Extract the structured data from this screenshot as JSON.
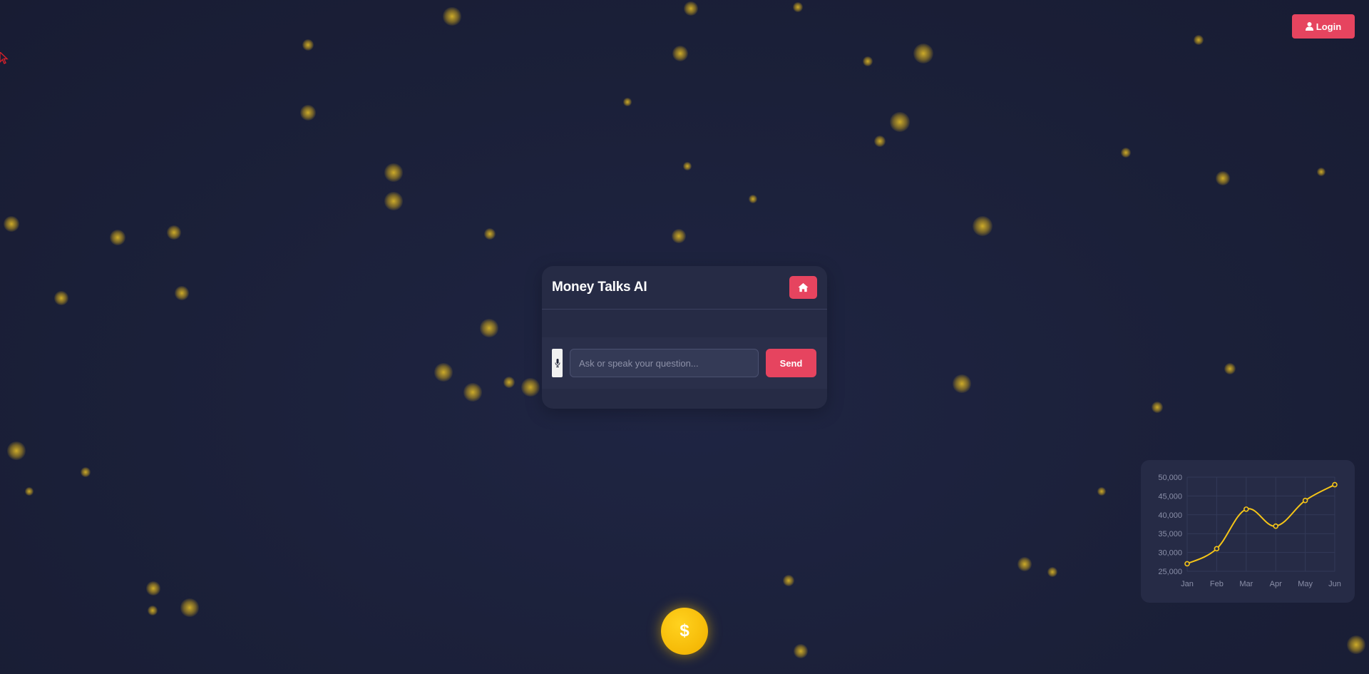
{
  "header": {
    "login_label": "Login",
    "login_icon": "user-icon"
  },
  "chat": {
    "title": "Money Talks AI",
    "home_icon": "home-icon",
    "mic_icon": "microphone-icon",
    "input_placeholder": "Ask or speak your question...",
    "input_value": "",
    "send_label": "Send"
  },
  "coin": {
    "symbol": "$"
  },
  "colors": {
    "background": "#1c2139",
    "accent": "#e6445f",
    "panel": "#262b45",
    "gold": "#f7c600",
    "particle": "#c9a22a"
  },
  "chart_data": {
    "type": "line",
    "categories": [
      "Jan",
      "Feb",
      "Mar",
      "Apr",
      "May",
      "Jun"
    ],
    "series": [
      {
        "values": [
          27000,
          31000,
          41500,
          37000,
          43800,
          48000
        ],
        "color": "#f5c518"
      }
    ],
    "y_ticks": [
      "50,000",
      "45,000",
      "40,000",
      "35,000",
      "30,000",
      "25,000"
    ],
    "ylim": [
      25000,
      50000
    ],
    "grid": true,
    "legend": "none",
    "title": "",
    "xlabel": "",
    "ylabel": ""
  }
}
